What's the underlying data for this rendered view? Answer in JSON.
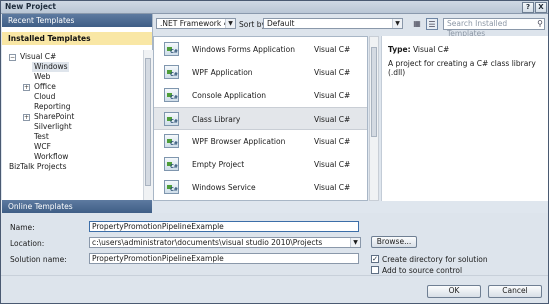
{
  "window": {
    "title": "New Project",
    "help_btn": "?",
    "close_btn": "X"
  },
  "left": {
    "recent_header": "Recent Templates",
    "installed_header": "Installed Templates",
    "tree": [
      {
        "label": "Visual C#",
        "expander": "⊟"
      },
      {
        "label": "Windows",
        "selected": true
      },
      {
        "label": "Web"
      },
      {
        "label": "Office",
        "expander": "⊞"
      },
      {
        "label": "Cloud"
      },
      {
        "label": "Reporting"
      },
      {
        "label": "SharePoint",
        "expander": "⊞"
      },
      {
        "label": "Silverlight"
      },
      {
        "label": "Test"
      },
      {
        "label": "WCF"
      },
      {
        "label": "Workflow"
      },
      {
        "label": "BizTalk Projects"
      }
    ],
    "online_header": "Online Templates"
  },
  "toolbar": {
    "framework": ".NET Framework 4",
    "sort_label": "Sort by:",
    "sort_value": "Default",
    "search_placeholder": "Search Installed Templates",
    "view_icons": [
      "medium-icons-view-icon",
      "list-view-icon"
    ]
  },
  "templates": [
    {
      "name": "Windows Forms Application",
      "lang": "Visual C#"
    },
    {
      "name": "WPF Application",
      "lang": "Visual C#"
    },
    {
      "name": "Console Application",
      "lang": "Visual C#"
    },
    {
      "name": "Class Library",
      "lang": "Visual C#",
      "selected": true
    },
    {
      "name": "WPF Browser Application",
      "lang": "Visual C#"
    },
    {
      "name": "Empty Project",
      "lang": "Visual C#"
    },
    {
      "name": "Windows Service",
      "lang": "Visual C#"
    }
  ],
  "details": {
    "type_label": "Type:",
    "type_value": "Visual C#",
    "description": "A project for creating a C# class library (.dll)"
  },
  "form": {
    "name_label": "Name:",
    "name_value": "PropertyPromotionPipelineExample",
    "location_label": "Location:",
    "location_value": "c:\\users\\administrator\\documents\\visual studio 2010\\Projects",
    "browse_label": "Browse...",
    "solution_label": "Solution name:",
    "solution_value": "PropertyPromotionPipelineExample",
    "create_dir_label": "Create directory for solution",
    "create_dir_checked": true,
    "source_control_label": "Add to source control",
    "source_control_checked": false
  },
  "buttons": {
    "ok": "OK",
    "cancel": "Cancel"
  },
  "colors": {
    "header_blue": "#4a678f",
    "installed_highlight": "#f9e7a5",
    "window_bg": "#dfe6ee"
  }
}
